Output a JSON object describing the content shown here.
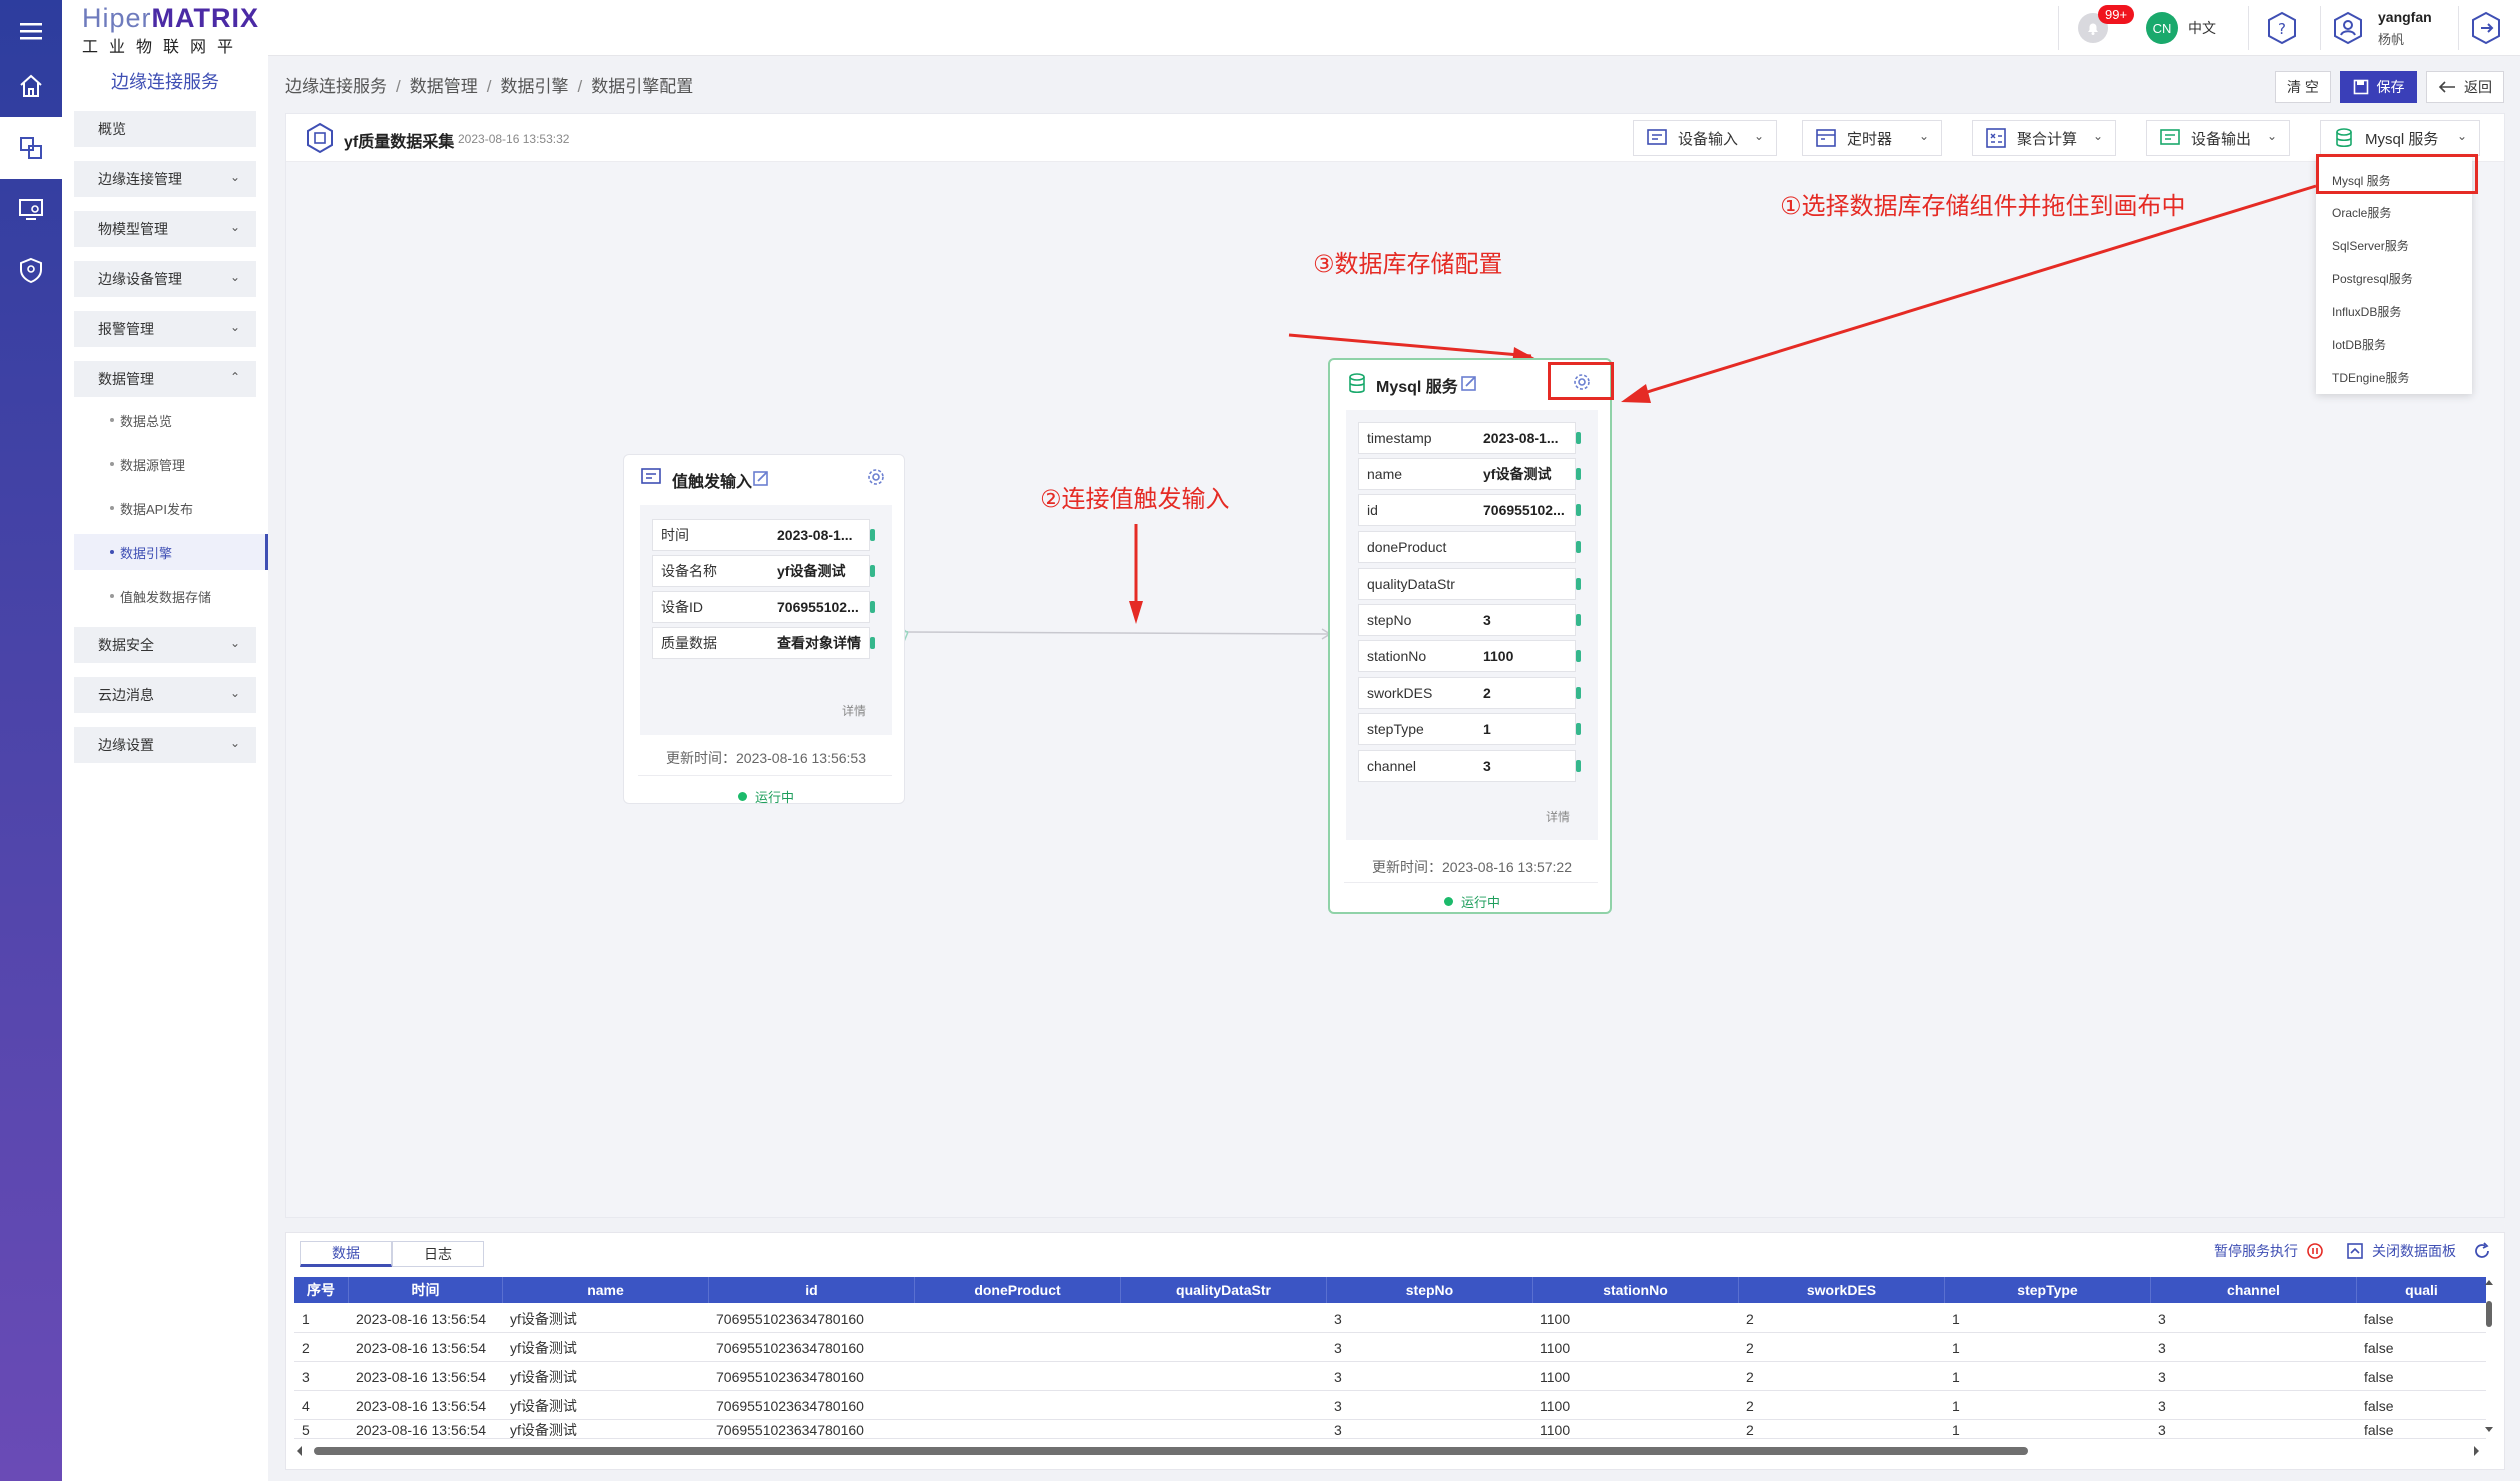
{
  "brand": {
    "line1_a": "Hiper",
    "line1_b": "MATRIX",
    "line2": "工业物联网平台"
  },
  "topbar": {
    "badge": "99+",
    "lang_code": "CN",
    "lang": "中文",
    "user": "yangfan",
    "user_sub": "杨帆"
  },
  "sidebar": {
    "title": "边缘连接服务",
    "menus": [
      {
        "label": "概览",
        "chevron": ""
      },
      {
        "label": "边缘连接管理",
        "chevron": "⌄"
      },
      {
        "label": "物模型管理",
        "chevron": "⌄"
      },
      {
        "label": "边缘设备管理",
        "chevron": "⌄"
      },
      {
        "label": "报警管理",
        "chevron": "⌄"
      },
      {
        "label": "数据管理",
        "chevron": "⌃"
      }
    ],
    "subs": [
      {
        "label": "数据总览"
      },
      {
        "label": "数据源管理"
      },
      {
        "label": "数据API发布"
      },
      {
        "label": "数据引擎"
      },
      {
        "label": "值触发数据存储"
      }
    ],
    "menus2": [
      {
        "label": "数据安全",
        "chevron": "⌄"
      },
      {
        "label": "云边消息",
        "chevron": "⌄"
      },
      {
        "label": "边缘设置",
        "chevron": "⌄"
      }
    ]
  },
  "breadcrumb": [
    "边缘连接服务",
    "数据管理",
    "数据引擎",
    "数据引擎配置"
  ],
  "breadcrumb_sep": "/",
  "actions": {
    "clear": "清 空",
    "save": "保存",
    "back": "返回"
  },
  "flow": {
    "name": "yf质量数据采集",
    "time": "2023-08-16 13:53:32",
    "tools": [
      {
        "label": "设备输入"
      },
      {
        "label": "定时器"
      },
      {
        "label": "聚合计算"
      },
      {
        "label": "设备输出"
      },
      {
        "label": "Mysql 服务"
      }
    ],
    "dropdown": [
      "Mysql 服务",
      "Oracle服务",
      "SqlServer服务",
      "Postgresql服务",
      "InfluxDB服务",
      "IotDB服务",
      "TDEngine服务"
    ]
  },
  "node1": {
    "title": "值触发输入",
    "fields": [
      {
        "k": "时间",
        "v": "2023-08-1..."
      },
      {
        "k": "设备名称",
        "v": "yf设备测试"
      },
      {
        "k": "设备ID",
        "v": "706955102..."
      },
      {
        "k": "质量数据",
        "v": "查看对象详情"
      }
    ],
    "detail": "详情",
    "updated": "更新时间：2023-08-16 13:56:53",
    "status": "运行中"
  },
  "node2": {
    "title": "Mysql 服务",
    "fields": [
      {
        "k": "timestamp",
        "v": "2023-08-1..."
      },
      {
        "k": "name",
        "v": "yf设备测试"
      },
      {
        "k": "id",
        "v": "706955102..."
      },
      {
        "k": "doneProduct",
        "v": ""
      },
      {
        "k": "qualityDataStr",
        "v": ""
      },
      {
        "k": "stepNo",
        "v": "3"
      },
      {
        "k": "stationNo",
        "v": "1100"
      },
      {
        "k": "sworkDES",
        "v": "2"
      },
      {
        "k": "stepType",
        "v": "1"
      },
      {
        "k": "channel",
        "v": "3"
      }
    ],
    "detail": "详情",
    "updated": "更新时间：2023-08-16 13:57:22",
    "status": "运行中"
  },
  "annotations": {
    "a1": "①选择数据库存储组件并拖住到画布中",
    "a2": "②连接值触发输入",
    "a3": "③数据库存储配置"
  },
  "colors": {
    "accent": "#3f4fb4",
    "annotation": "#e52b25",
    "running": "#1cba6b",
    "table_head": "#3b55c4"
  },
  "data_panel": {
    "tabs": [
      "数据",
      "日志"
    ],
    "pause": "暂停服务执行",
    "close": "关闭数据面板",
    "columns": [
      "序号",
      "时间",
      "name",
      "id",
      "doneProduct",
      "qualityDataStr",
      "stepNo",
      "stationNo",
      "sworkDES",
      "stepType",
      "channel",
      "quali"
    ],
    "rows": [
      [
        "1",
        "2023-08-16 13:56:54",
        "yf设备测试",
        "7069551023634780160",
        "",
        "",
        "3",
        "1100",
        "2",
        "1",
        "3",
        "false"
      ],
      [
        "2",
        "2023-08-16 13:56:54",
        "yf设备测试",
        "7069551023634780160",
        "",
        "",
        "3",
        "1100",
        "2",
        "1",
        "3",
        "false"
      ],
      [
        "3",
        "2023-08-16 13:56:54",
        "yf设备测试",
        "7069551023634780160",
        "",
        "",
        "3",
        "1100",
        "2",
        "1",
        "3",
        "false"
      ],
      [
        "4",
        "2023-08-16 13:56:54",
        "yf设备测试",
        "7069551023634780160",
        "",
        "",
        "3",
        "1100",
        "2",
        "1",
        "3",
        "false"
      ],
      [
        "5",
        "2023-08-16 13:56:54",
        "yf设备测试",
        "7069551023634780160",
        "",
        "",
        "3",
        "1100",
        "2",
        "1",
        "3",
        "false"
      ]
    ]
  }
}
